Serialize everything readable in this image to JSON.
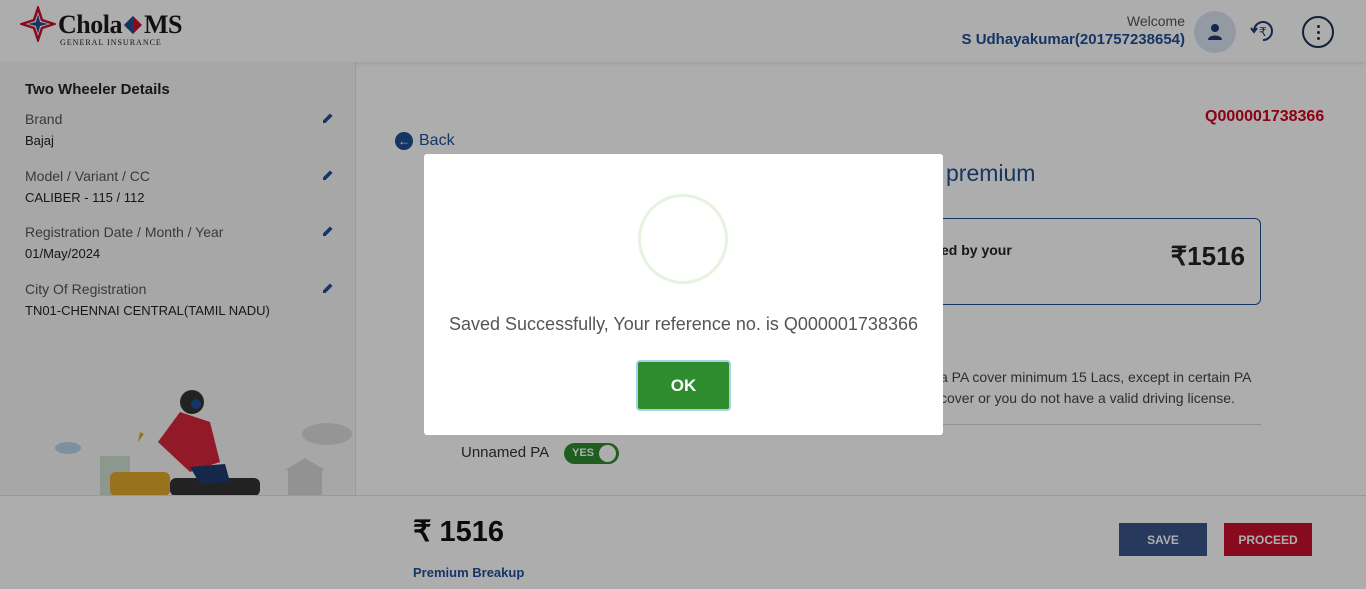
{
  "header": {
    "logo_text": "Chola",
    "logo_text_2": "MS",
    "logo_sub": "GENERAL INSURANCE",
    "welcome": "Welcome",
    "username": "S Udhayakumar(201757238654)"
  },
  "sidebar": {
    "title": "Two Wheeler Details",
    "fields": [
      {
        "label": "Brand",
        "value": "Bajaj"
      },
      {
        "label": "Model / Variant / CC",
        "value": "CALIBER - 115 / 112"
      },
      {
        "label": "Registration Date / Month / Year",
        "value": "01/May/2024"
      },
      {
        "label": "City Of Registration",
        "value": "TN01-CHENNAI CENTRAL(TAMIL NADU)"
      }
    ]
  },
  "main": {
    "reference": "Q000001738366",
    "back_label": "Back",
    "premium_heading": "premium",
    "card_text": "ed by your",
    "card_price": "₹1516",
    "pa_text": "a PA cover minimum 15 Lacs, except in certain PA cover or you do not have a valid driving license.",
    "unnamed_pa_label": "Unnamed PA",
    "toggle_label": "YES"
  },
  "footer": {
    "price": "₹ 1516",
    "breakup_label": "Premium Breakup",
    "save_label": "SAVE",
    "proceed_label": "PROCEED"
  },
  "modal": {
    "message": "Saved Successfully, Your reference no. is Q000001738366",
    "ok_label": "OK"
  },
  "colors": {
    "brand_blue": "#1f4e96",
    "reference_red": "#d0021b",
    "ok_green": "#2e8b2e",
    "save_blue": "#3a5488",
    "proceed_red": "#c8102e"
  }
}
